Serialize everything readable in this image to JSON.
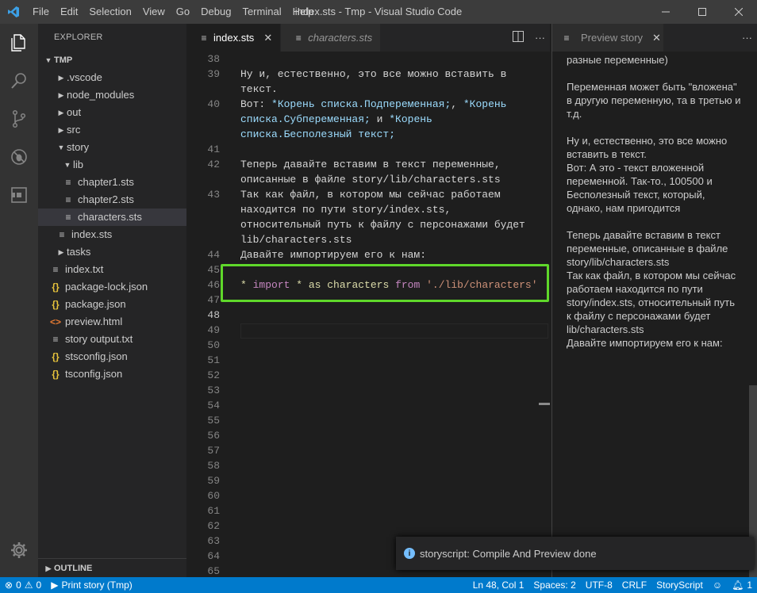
{
  "window": {
    "title": "index.sts - Tmp - Visual Studio Code"
  },
  "menu": [
    "File",
    "Edit",
    "Selection",
    "View",
    "Go",
    "Debug",
    "Terminal",
    "Help"
  ],
  "sidebar": {
    "title": "EXPLORER",
    "root": "TMP",
    "items": [
      {
        "label": ".vscode",
        "depth": 1,
        "type": "folder",
        "open": false
      },
      {
        "label": "node_modules",
        "depth": 1,
        "type": "folder",
        "open": false
      },
      {
        "label": "out",
        "depth": 1,
        "type": "folder",
        "open": false
      },
      {
        "label": "src",
        "depth": 1,
        "type": "folder",
        "open": false
      },
      {
        "label": "story",
        "depth": 1,
        "type": "folder",
        "open": true
      },
      {
        "label": "lib",
        "depth": 2,
        "type": "folder",
        "open": true
      },
      {
        "label": "chapter1.sts",
        "depth": 3,
        "type": "txt"
      },
      {
        "label": "chapter2.sts",
        "depth": 3,
        "type": "txt"
      },
      {
        "label": "characters.sts",
        "depth": 3,
        "type": "txt",
        "selected": true
      },
      {
        "label": "index.sts",
        "depth": 2,
        "type": "txt"
      },
      {
        "label": "tasks",
        "depth": 1,
        "type": "folder",
        "open": false
      },
      {
        "label": "index.txt",
        "depth": 1,
        "type": "txt"
      },
      {
        "label": "package-lock.json",
        "depth": 1,
        "type": "json"
      },
      {
        "label": "package.json",
        "depth": 1,
        "type": "json"
      },
      {
        "label": "preview.html",
        "depth": 1,
        "type": "html"
      },
      {
        "label": "story output.txt",
        "depth": 1,
        "type": "txt"
      },
      {
        "label": "stsconfig.json",
        "depth": 1,
        "type": "json"
      },
      {
        "label": "tsconfig.json",
        "depth": 1,
        "type": "json"
      }
    ],
    "outline": "OUTLINE"
  },
  "editor": {
    "tabs": [
      {
        "label": "index.sts",
        "active": true
      },
      {
        "label": "characters.sts",
        "active": false
      }
    ],
    "lines": [
      {
        "n": "38",
        "text": ""
      },
      {
        "n": "39",
        "text": "Ну и, естественно, это все можно вставить в"
      },
      {
        "n": "",
        "text": "текст."
      },
      {
        "n": "40",
        "text": "Вот: *Корень списка.Подпеременная;, *Корень"
      },
      {
        "n": "",
        "text": "списка.Субпеременная; и *Корень"
      },
      {
        "n": "",
        "text": "списка.Бесполезный текст;"
      },
      {
        "n": "41",
        "text": ""
      },
      {
        "n": "42",
        "text": "Теперь давайте вставим в текст переменные,"
      },
      {
        "n": "",
        "text": "описанные в файле story/lib/characters.sts"
      },
      {
        "n": "43",
        "text": "Так как файл, в котором мы сейчас работаем"
      },
      {
        "n": "",
        "text": "находится по пути story/index.sts,"
      },
      {
        "n": "",
        "text": "относительный путь к файлу с персонажами будет"
      },
      {
        "n": "",
        "text": "lib/characters.sts"
      },
      {
        "n": "44",
        "text": "Давайте импортируем его к нам:"
      },
      {
        "n": "45",
        "text": ""
      },
      {
        "n": "46",
        "text": "* import * as characters from './lib/characters'"
      },
      {
        "n": "47",
        "text": ""
      },
      {
        "n": "48",
        "text": ""
      },
      {
        "n": "49",
        "text": ""
      },
      {
        "n": "50",
        "text": ""
      },
      {
        "n": "51",
        "text": ""
      },
      {
        "n": "52",
        "text": ""
      },
      {
        "n": "53",
        "text": ""
      },
      {
        "n": "54",
        "text": ""
      },
      {
        "n": "55",
        "text": ""
      },
      {
        "n": "56",
        "text": ""
      },
      {
        "n": "57",
        "text": ""
      },
      {
        "n": "58",
        "text": ""
      },
      {
        "n": "59",
        "text": ""
      },
      {
        "n": "60",
        "text": ""
      },
      {
        "n": "61",
        "text": ""
      },
      {
        "n": "62",
        "text": ""
      },
      {
        "n": "63",
        "text": ""
      },
      {
        "n": "64",
        "text": ""
      },
      {
        "n": "65",
        "text": ""
      }
    ],
    "line40_parts": [
      "Вот: ",
      "*Корень списка.Подпеременная;",
      ", ",
      "*Корень"
    ],
    "line40b": "списка.Субпеременная;",
    "line40b_rest": " и ",
    "line40b_end": "*Корень",
    "line40c": "списка.Бесполезный текст;",
    "import_line": {
      "star": "* ",
      "import": "import",
      "s1": " * ",
      "as": "as",
      "s2": " ",
      "name": "characters",
      "s3": " ",
      "from": "from",
      "s4": " ",
      "path": "'./lib/characters'"
    }
  },
  "preview": {
    "tab": "Preview story",
    "paragraphs": [
      "разные переменные)",
      "Переменная может быть \"вложена\" в другую переменную, та в третью и т.д.",
      "Ну и, естественно, это все можно вставить в текст.\nВот: А это - текст вложенной переменной. Так-то., 100500 и Бесполезный текст, который, однако, нам пригодится",
      "Теперь давайте вставим в текст переменные, описанные в файле story/lib/characters.sts\nТак как файл, в котором мы сейчас работаем находится по пути story/index.sts, относительный путь к файлу с персонажами будет lib/characters.sts\nДавайте импортируем его к нам:"
    ]
  },
  "notification": {
    "text": "storyscript: Compile And Preview done"
  },
  "status": {
    "errors": "0",
    "warnings": "0",
    "run": "Print story (Tmp)",
    "position": "Ln 48, Col 1",
    "spaces": "Spaces: 2",
    "encoding": "UTF-8",
    "eol": "CRLF",
    "language": "StoryScript",
    "bell_count": "1"
  },
  "colors": {
    "accent": "#007acc",
    "highlight": "#5fd82a"
  }
}
